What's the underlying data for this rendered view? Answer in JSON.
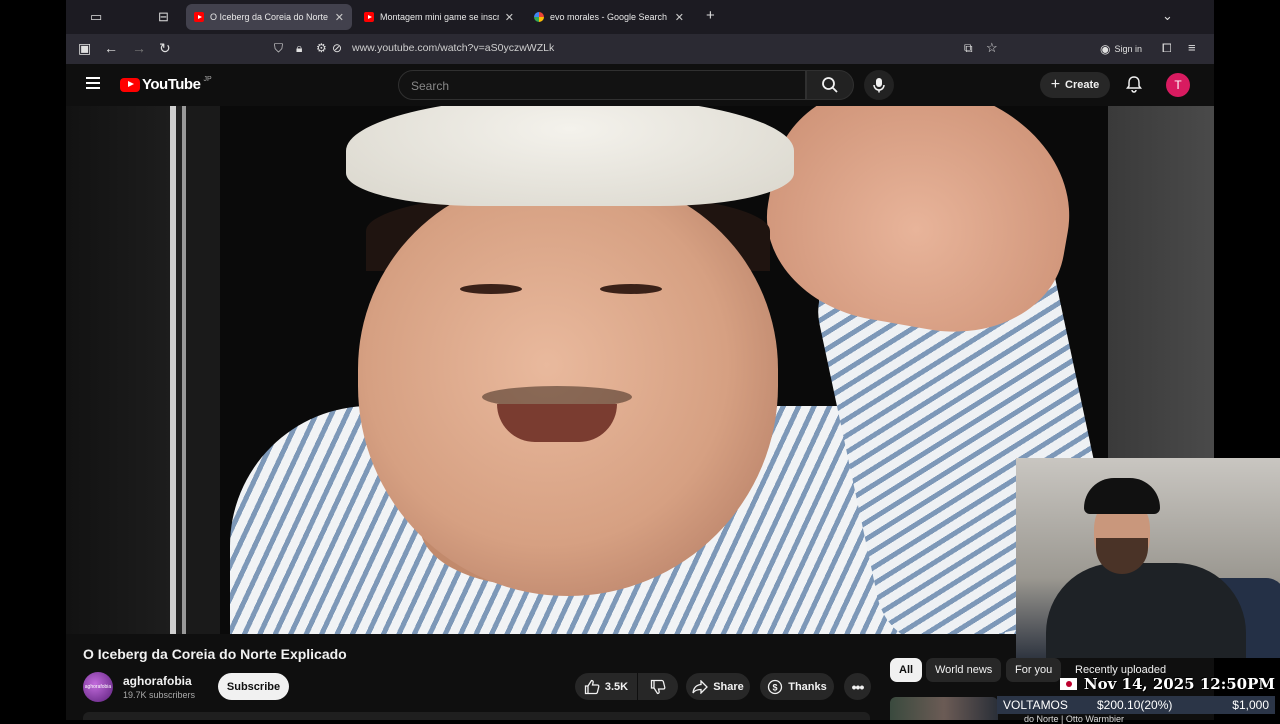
{
  "browser": {
    "tabs": [
      {
        "title": "O Iceberg da Coreia do Norte Explicado",
        "favicon": "youtube-icon",
        "active": true
      },
      {
        "title": "Montagem mini game se inscreva",
        "favicon": "youtube-icon",
        "active": false
      },
      {
        "title": "evo morales - Google Search",
        "favicon": "google-icon",
        "active": false
      }
    ],
    "url": "www.youtube.com/watch?v=aS0yczwWZLk",
    "sign_in_label": "Sign in"
  },
  "youtube": {
    "logo_text": "YouTube",
    "region_code": "JP",
    "search_placeholder": "Search",
    "create_label": "Create",
    "avatar_letter": "T"
  },
  "video": {
    "title": "O Iceberg da Coreia do Norte Explicado",
    "channel_name": "aghorafobia",
    "channel_avatar_text": "aghorafobia",
    "subscribers": "19.7K subscribers",
    "subscribe_label": "Subscribe",
    "likes": "3.5K",
    "share_label": "Share",
    "thanks_label": "Thanks"
  },
  "chips": {
    "all": "All",
    "world_news": "World news",
    "for_you": "For you",
    "recently_uploaded": "Recently uploaded"
  },
  "overlay": {
    "date_text": "Nov 14, 2025 12:50PM",
    "ticker_label": "VOLTAMOS",
    "ticker_amount": "$200.10(20%)",
    "ticker_goal": "$1,000",
    "peek_text": "do Norte | Otto Warmbier"
  },
  "colors": {
    "youtube_red": "#ff0000",
    "avatar": "#d81b60",
    "background": "#0f0f0f"
  }
}
